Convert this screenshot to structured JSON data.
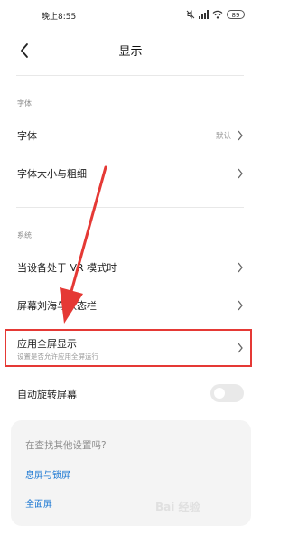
{
  "status_bar": {
    "time": "晚上8:55",
    "battery": "89"
  },
  "header": {
    "title": "显示"
  },
  "sections": {
    "font": {
      "label": "字体",
      "items": [
        {
          "title": "字体",
          "value": "默认"
        },
        {
          "title": "字体大小与粗细"
        }
      ]
    },
    "system": {
      "label": "系统",
      "items": [
        {
          "title": "当设备处于 VR 模式时"
        },
        {
          "title": "屏幕刘海与状态栏"
        },
        {
          "title": "应用全屏显示",
          "subtitle": "设置是否允许应用全屏运行"
        },
        {
          "title": "自动旋转屏幕",
          "toggle_on": false
        }
      ]
    }
  },
  "suggestions": {
    "question": "在查找其他设置吗?",
    "links": [
      "息屏与锁屏",
      "全面屏"
    ]
  },
  "watermark": "Bai 经验",
  "colors": {
    "accent_link": "#1976d2",
    "highlight": "#e53935",
    "arrow": "#e53935"
  }
}
